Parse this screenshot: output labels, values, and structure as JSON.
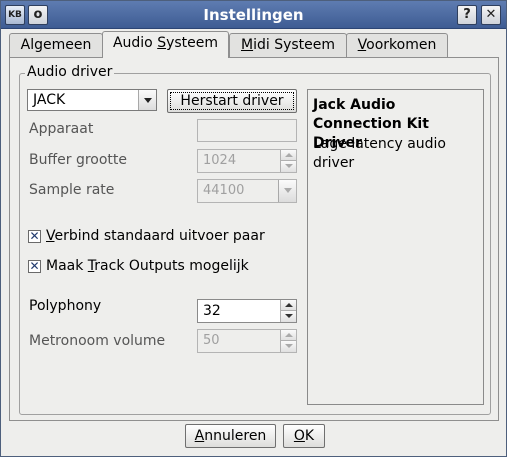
{
  "window": {
    "title": "Instellingen",
    "help_glyph": "?",
    "close_glyph": "✕",
    "sticky_glyph": "o"
  },
  "tabs": [
    {
      "label_pre": "Algemeen",
      "label_u": "",
      "label_post": ""
    },
    {
      "label_pre": "Audio ",
      "label_u": "S",
      "label_post": "ysteem"
    },
    {
      "label_pre": "",
      "label_u": "M",
      "label_post": "idi Systeem"
    },
    {
      "label_pre": "",
      "label_u": "V",
      "label_post": "oorkomen"
    }
  ],
  "audio_driver": {
    "group_label": "Audio driver",
    "driver_value": "JACK",
    "restart_button": "Herstart driver",
    "device_label": "Apparaat",
    "device_value": "",
    "buffer_label": "Buffer grootte",
    "buffer_value": "1024",
    "sample_label": "Sample rate",
    "sample_value": "44100",
    "connect_pre": "",
    "connect_u": "V",
    "connect_post": "erbind standaard uitvoer paar",
    "connect_checked": true,
    "track_pre": "Maak ",
    "track_u": "T",
    "track_post": "rack Outputs mogelijk",
    "track_checked": true,
    "polyphony_label": "Polyphony",
    "polyphony_value": "32",
    "metronome_label": "Metronoom volume",
    "metronome_value": "50",
    "info_title": "Jack Audio Connection Kit Driver",
    "info_desc": "Lage latency audio driver",
    "check_mark": "✕"
  },
  "buttons": {
    "cancel_pre": "",
    "cancel_u": "A",
    "cancel_post": "nnuleren",
    "ok_pre": "",
    "ok_u": "O",
    "ok_post": "K"
  }
}
